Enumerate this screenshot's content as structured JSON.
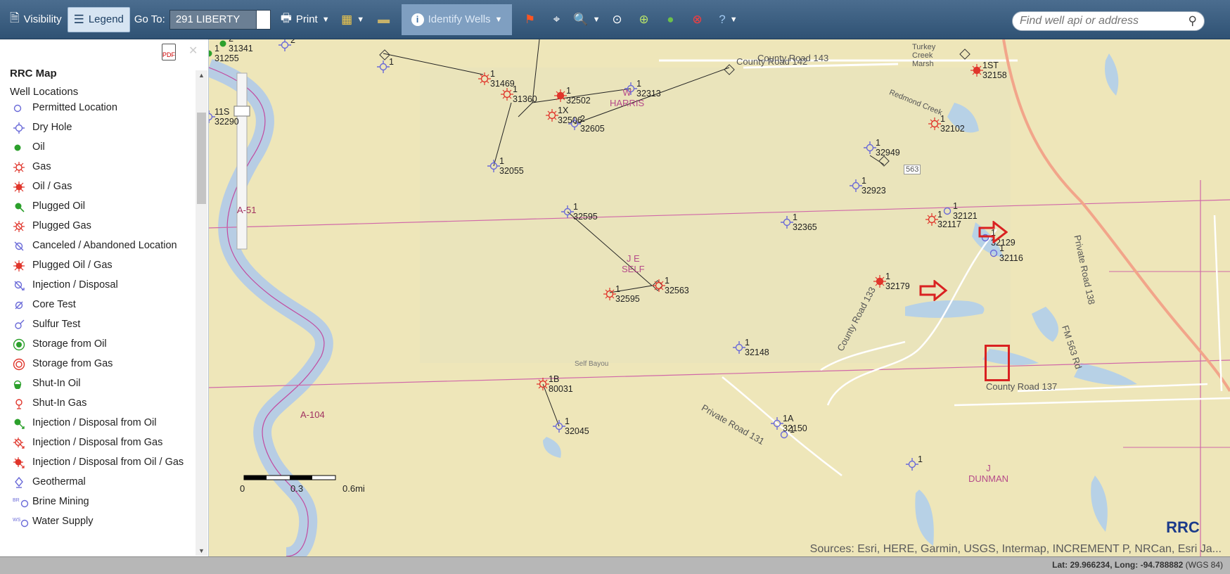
{
  "toolbar": {
    "visibility": "Visibility",
    "legend": "Legend",
    "goto_label": "Go To:",
    "goto_value": "291 LIBERTY",
    "print": "Print",
    "identify": "Identify Wells",
    "search_placeholder": "Find well api or address"
  },
  "panel": {
    "title": "RRC Map",
    "subtitle": "Well Locations",
    "items": [
      {
        "label": "Permitted Location",
        "icon": "permitted-location-icon"
      },
      {
        "label": "Dry Hole",
        "icon": "dry-hole-icon"
      },
      {
        "label": "Oil",
        "icon": "oil-icon"
      },
      {
        "label": "Gas",
        "icon": "gas-icon"
      },
      {
        "label": "Oil / Gas",
        "icon": "oil-gas-icon"
      },
      {
        "label": "Plugged Oil",
        "icon": "plugged-oil-icon"
      },
      {
        "label": "Plugged Gas",
        "icon": "plugged-gas-icon"
      },
      {
        "label": "Canceled / Abandoned Location",
        "icon": "canceled-location-icon"
      },
      {
        "label": "Plugged Oil / Gas",
        "icon": "plugged-oil-gas-icon"
      },
      {
        "label": "Injection / Disposal",
        "icon": "injection-disposal-icon"
      },
      {
        "label": "Core Test",
        "icon": "core-test-icon"
      },
      {
        "label": "Sulfur Test",
        "icon": "sulfur-test-icon"
      },
      {
        "label": "Storage from Oil",
        "icon": "storage-oil-icon"
      },
      {
        "label": "Storage from Gas",
        "icon": "storage-gas-icon"
      },
      {
        "label": "Shut-In Oil",
        "icon": "shut-in-oil-icon"
      },
      {
        "label": "Shut-In Gas",
        "icon": "shut-in-gas-icon"
      },
      {
        "label": "Injection / Disposal from Oil",
        "icon": "injection-oil-icon"
      },
      {
        "label": "Injection / Disposal from Gas",
        "icon": "injection-gas-icon"
      },
      {
        "label": "Injection / Disposal from Oil / Gas",
        "icon": "injection-oil-gas-icon"
      },
      {
        "label": "Geothermal",
        "icon": "geothermal-icon"
      },
      {
        "label": "Brine Mining",
        "icon": "brine-mining-icon"
      },
      {
        "label": "Water Supply",
        "icon": "water-supply-icon"
      }
    ]
  },
  "map": {
    "wells": [
      {
        "num": "2",
        "api": "31341"
      },
      {
        "num": "2",
        "api": ""
      },
      {
        "num": "1",
        "api": "31255"
      },
      {
        "num": "1",
        "api": ""
      },
      {
        "num": "11S",
        "api": "32290"
      },
      {
        "num": "1",
        "api": "31469"
      },
      {
        "num": "1",
        "api": "31360"
      },
      {
        "num": "1",
        "api": "32502"
      },
      {
        "num": "1X",
        "api": "32506"
      },
      {
        "num": "1",
        "api": "32313"
      },
      {
        "num": "2",
        "api": "32605"
      },
      {
        "num": "1",
        "api": "32055"
      },
      {
        "num": "1",
        "api": "32595"
      },
      {
        "num": "1",
        "api": "32595"
      },
      {
        "num": "1",
        "api": "32563"
      },
      {
        "num": "1B",
        "api": "80031"
      },
      {
        "num": "1",
        "api": "32045"
      },
      {
        "num": "1",
        "api": "32148"
      },
      {
        "num": "1",
        "api": "32365"
      },
      {
        "num": "1",
        "api": "32923"
      },
      {
        "num": "1",
        "api": "32949"
      },
      {
        "num": "1",
        "api": "32102"
      },
      {
        "num": "1ST",
        "api": "32158"
      },
      {
        "num": "1",
        "api": "32121"
      },
      {
        "num": "1",
        "api": "32117"
      },
      {
        "num": "1",
        "api": "32129"
      },
      {
        "num": "1",
        "api": "32116"
      },
      {
        "num": "1",
        "api": "32179"
      },
      {
        "num": "1",
        "api": ""
      },
      {
        "num": "1A",
        "api": "32150"
      },
      {
        "num": "1",
        "api": ""
      }
    ],
    "roads": [
      "County Road 143",
      "County Road 142",
      "County Road 137",
      "Private Road 138",
      "FM 563 Rd",
      "Private Road 131",
      "County Road 133",
      "563",
      "Self Bayou"
    ],
    "places": [
      "Turkey\nCreek\nMarsh",
      "Redmond Creek"
    ],
    "owners": [
      "W\nHARRIS",
      "J E\nSELF",
      "J\nDUNMAN"
    ],
    "abstracts": [
      "A-51",
      "A-104"
    ],
    "scale": {
      "a": "0",
      "b": "0.3",
      "c": "0.6mi"
    },
    "sources": "Sources: Esri, HERE, Garmin, USGS, Intermap, INCREMENT P, NRCan, Esri Ja...",
    "logo": "RRC"
  },
  "status": {
    "lat_label": "Lat:",
    "lat": "29.966234,",
    "long_label": "Long:",
    "long": "-94.788882",
    "datum": "(WGS 84)"
  },
  "colors": {
    "toolbar": "#3c5f82",
    "map_bg": "#eee6b9",
    "annotation": "#d92121",
    "well_blue": "#6a6ad8",
    "well_red": "#e0352b"
  }
}
